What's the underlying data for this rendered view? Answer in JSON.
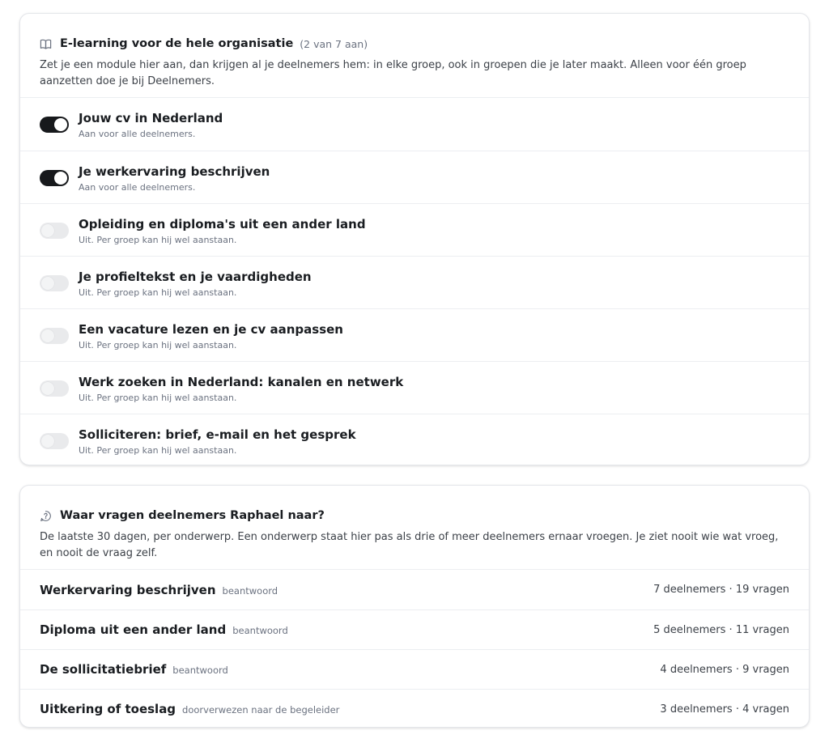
{
  "elearning": {
    "title": "E-learning voor de hele organisatie",
    "count": "(2 van 7 aan)",
    "description": "Zet je een module hier aan, dan krijgen al je deelnemers hem: in elke groep, ook in groepen die je later maakt. Alleen voor één groep aanzetten doe je bij Deelnemers.",
    "icon": "book-icon",
    "modules": [
      {
        "title": "Jouw cv in Nederland",
        "status": "Aan voor alle deelnemers.",
        "enabled": true
      },
      {
        "title": "Je werkervaring beschrijven",
        "status": "Aan voor alle deelnemers.",
        "enabled": true
      },
      {
        "title": "Opleiding en diploma's uit een ander land",
        "status": "Uit. Per groep kan hij wel aanstaan.",
        "enabled": false
      },
      {
        "title": "Je profieltekst en je vaardigheden",
        "status": "Uit. Per groep kan hij wel aanstaan.",
        "enabled": false
      },
      {
        "title": "Een vacature lezen en je cv aanpassen",
        "status": "Uit. Per groep kan hij wel aanstaan.",
        "enabled": false
      },
      {
        "title": "Werk zoeken in Nederland: kanalen en netwerk",
        "status": "Uit. Per groep kan hij wel aanstaan.",
        "enabled": false
      },
      {
        "title": "Solliciteren: brief, e-mail en het gesprek",
        "status": "Uit. Per groep kan hij wel aanstaan.",
        "enabled": false
      }
    ]
  },
  "questions": {
    "title": "Waar vragen deelnemers Raphael naar?",
    "description": "De laatste 30 dagen, per onderwerp. Een onderwerp staat hier pas als drie of meer deelnemers ernaar vroegen. Je ziet nooit wie wat vroeg, en nooit de vraag zelf.",
    "icon": "chat-question-icon",
    "topics": [
      {
        "topic": "Werkervaring beschrijven",
        "status": "beantwoord",
        "stats": "7 deelnemers · 19 vragen"
      },
      {
        "topic": "Diploma uit een ander land",
        "status": "beantwoord",
        "stats": "5 deelnemers · 11 vragen"
      },
      {
        "topic": "De sollicitatiebrief",
        "status": "beantwoord",
        "stats": "4 deelnemers · 9 vragen"
      },
      {
        "topic": "Uitkering of toeslag",
        "status": "doorverwezen naar de begeleider",
        "stats": "3 deelnemers · 4 vragen"
      }
    ]
  },
  "colors": {
    "toggle_on": "#17191c",
    "toggle_off": "#e9eaec",
    "text_primary": "#1a1d21",
    "text_muted": "#6b7280",
    "border": "#eceef1"
  }
}
